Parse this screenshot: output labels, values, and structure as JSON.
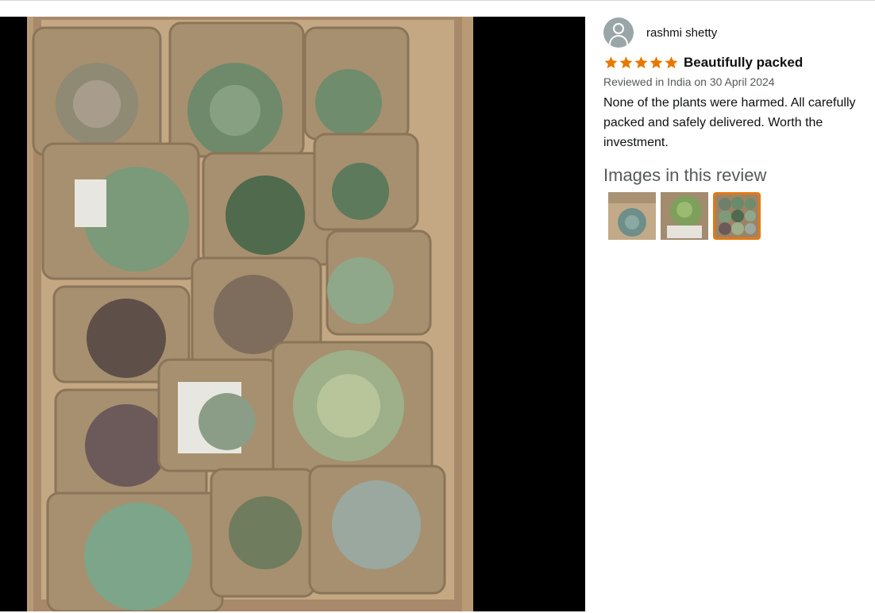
{
  "review": {
    "reviewer_name": "rashmi shetty",
    "rating": 5,
    "rating_max": 5,
    "title": "Beautifully packed",
    "date_line": "Reviewed in India on 30 April 2024",
    "body": "None of the plants were harmed. All carefully packed and safely delivered. Worth the investment.",
    "images_heading": "Images in this review",
    "selected_image_index": 2
  },
  "colors": {
    "star": "#e67a00",
    "thumb_selected_border": "#e47911",
    "viewer_background": "#000000"
  },
  "icons": {
    "avatar": "user-avatar-icon",
    "star": "star-icon"
  }
}
